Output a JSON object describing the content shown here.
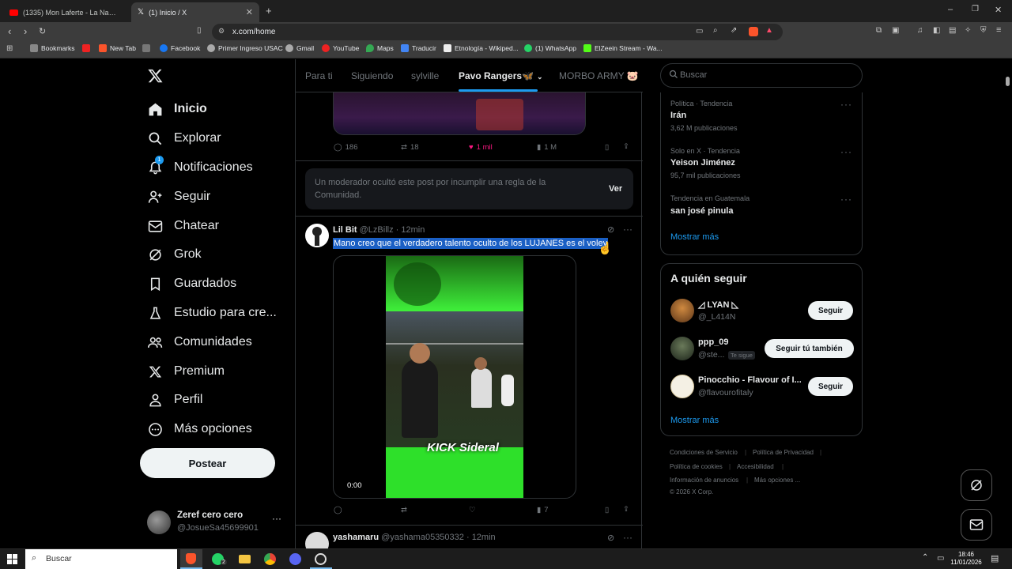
{
  "browser": {
    "tabs": [
      {
        "title": "(1335) Mon Laferte - La Nave del Ol"
      },
      {
        "title": "(1) Inicio / X"
      }
    ],
    "url": "x.com/home",
    "bookmarks": [
      "Bookmarks",
      "New Tab",
      "Facebook",
      "Primer Ingreso USAC",
      "Gmail",
      "YouTube",
      "Maps",
      "Traducir",
      "Etnología - Wikiped...",
      "(1) WhatsApp",
      "ElZeein Stream - Wa..."
    ]
  },
  "sidebar": {
    "items": [
      {
        "label": "Inicio",
        "icon": "home-icon"
      },
      {
        "label": "Explorar",
        "icon": "search-icon"
      },
      {
        "label": "Notificaciones",
        "icon": "bell-icon",
        "badge": "1"
      },
      {
        "label": "Seguir",
        "icon": "add-person-icon"
      },
      {
        "label": "Chatear",
        "icon": "mail-icon"
      },
      {
        "label": "Grok",
        "icon": "grok-icon"
      },
      {
        "label": "Guardados",
        "icon": "bookmark-icon"
      },
      {
        "label": "Estudio para cre...",
        "icon": "flask-icon"
      },
      {
        "label": "Comunidades",
        "icon": "people-icon"
      },
      {
        "label": "Premium",
        "icon": "x-icon"
      },
      {
        "label": "Perfil",
        "icon": "person-icon"
      },
      {
        "label": "Más opciones",
        "icon": "more-circle-icon"
      }
    ],
    "post_button": "Postear",
    "account": {
      "name": "Zeref cero cero",
      "handle": "@JosueSa45699901"
    }
  },
  "feed": {
    "tabs": [
      "Para ti",
      "Siguiendo",
      "sylville",
      "Pavo Rangers🦋",
      "MORBO ARMY 🐷"
    ],
    "active_tab": 3,
    "prev_post_actions": {
      "replies": "186",
      "reposts": "18",
      "likes": "1 mil",
      "views": "1 M"
    },
    "moderated_notice": {
      "text": "Un moderador ocultó este post por incumplir una regla de la Comunidad.",
      "button": "Ver"
    },
    "post": {
      "name": "Lil Bit",
      "handle": "@LzBillz",
      "time": "· 12min",
      "text": "Mano creo que el verdadero talento oculto de los LUJANES es el voley",
      "video_time": "0:00",
      "video_overlay": "KICK Sideral",
      "views": "7"
    },
    "next_post": {
      "name": "yashamaru",
      "handle": "@yashama05350332",
      "time": "· 12min"
    }
  },
  "right": {
    "search_placeholder": "Buscar",
    "trends": [
      {
        "meta": "Política · Tendencia",
        "name": "Irán",
        "count": "3,62 M publicaciones"
      },
      {
        "meta": "Solo en X · Tendencia",
        "name": "Yeison Jiménez",
        "count": "95,7 mil publicaciones"
      },
      {
        "meta": "Tendencia en Guatemala",
        "name": "san josé pinula",
        "count": ""
      }
    ],
    "show_more": "Mostrar más",
    "who_to_follow_title": "A quién seguir",
    "who_to_follow": [
      {
        "name": "◿ LYAN ◺",
        "handle": "@_L414N",
        "button": "Seguir",
        "follows_you": ""
      },
      {
        "name": "ppp_09",
        "handle": "@ste...",
        "button": "Seguir tú también",
        "follows_you": "Te sigue"
      },
      {
        "name": "Pinocchio - Flavour of I...",
        "handle": "@flavourofitaly",
        "button": "Seguir",
        "follows_you": ""
      }
    ],
    "show_more_2": "Mostrar más",
    "footer": [
      "Condiciones de Servicio",
      "Política de Privacidad",
      "Política de cookies",
      "Accesibilidad",
      "Información de anuncios",
      "Más opciones ...",
      "© 2026 X Corp."
    ]
  },
  "taskbar": {
    "search_placeholder": "Buscar",
    "whatsapp_badge": "2",
    "time": "18:46",
    "date": "11/01/2026"
  },
  "colors": {
    "accent": "#1d9bf0",
    "like": "#f91880",
    "background": "#000000",
    "video_green": "#2ee02a"
  }
}
